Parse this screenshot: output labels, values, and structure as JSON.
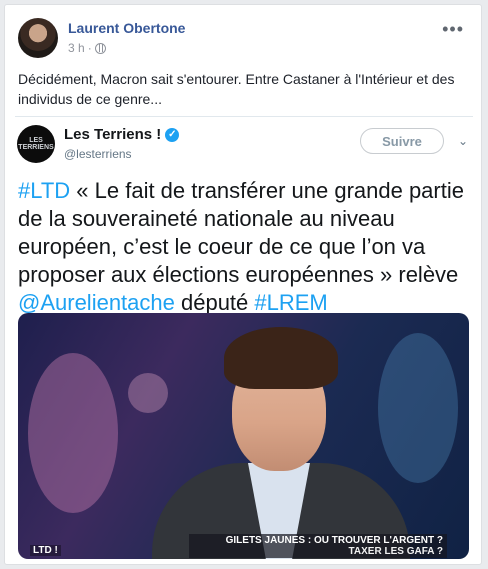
{
  "post": {
    "author": "Laurent Obertone",
    "time": "3 h",
    "more_label": "•••",
    "status_text": "Décidément, Macron sait s'entourer. Entre Castaner à l'Intérieur et des individus de ce genre..."
  },
  "tweet": {
    "name": "Les Terriens !",
    "verified_mark": "✓",
    "handle": "@lesterriens",
    "avatar_text": "LES TERRIENS",
    "follow_label": "Suivre",
    "chevron": "⌄",
    "text_parts": {
      "hashtag1": "#LTD",
      "body": " « Le fait de transférer une grande partie de la souveraineté nationale au niveau européen, c’est le coeur de ce que l’on va proposer aux élections européennes » relève ",
      "mention": "@Aurelientache",
      "middle": " député ",
      "hashtag2": "#LREM"
    },
    "media": {
      "caption_line1": "GILETS JAUNES : OU TROUVER L'ARGENT ?",
      "caption_line2": "TAXER LES GAFA ?",
      "logo_text": "LTD !"
    }
  },
  "colors": {
    "link": "#1da1f2",
    "author": "#385898",
    "verified": "#1da1f2"
  }
}
